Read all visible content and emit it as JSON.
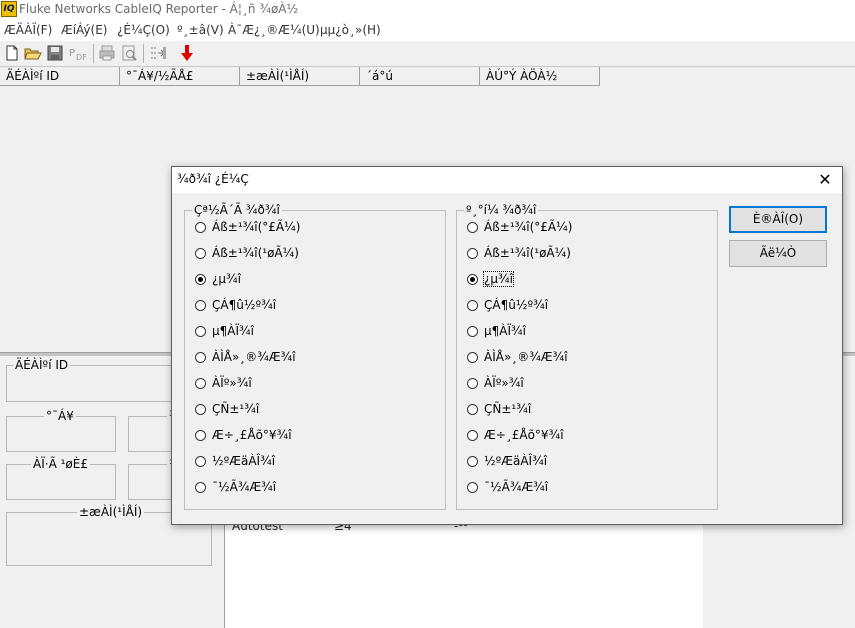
{
  "window": {
    "app_icon_text": "IQ",
    "title": "Fluke Networks CableIQ Reporter - Á¦¸ñ ¾øÀ½"
  },
  "menu": [
    "ÆÄÀÏ(F)",
    "ÆíÁý(E)",
    "¿É¼Ç(O)",
    "º¸±â(V)",
    "À¯Æ¿¸®Æ¼(U)",
    "µµ¿ò¸»(H)"
  ],
  "toolbar": {
    "icons": [
      "new-file-icon",
      "open-folder-icon",
      "save-icon",
      "pdf-icon",
      "print-icon",
      "print-preview-icon",
      "import-icon",
      "download-arrow-icon"
    ],
    "pdf_text": "PDF"
  },
  "list_columns": [
    "ÄÉÀÌºí ID",
    "°¯Á¥/½ÃÅ£",
    "±æÀÌ(¹ÌÅÍ)",
    "´á°ú",
    "ÀÚ°Ý ÀÖÀ½"
  ],
  "detail_panel": {
    "cable_id_label": "ÄÉÀÌºí ID",
    "box1_label": "°¯Á¥",
    "box2_label": "ÀÏ·Ã ¹øÈ£",
    "length_label": "±æÀÌ(¹ÌÅÍ)",
    "right_label_1": "¾",
    "right_label_2": "¹"
  },
  "lower_list": {
    "cells": [
      "Autotest",
      "≥4",
      "-¹¹"
    ]
  },
  "dialog": {
    "title": "¾ð¾î ¿É¼Ç",
    "close_glyph": "✕",
    "left_group": {
      "label": "Çª½Ã´Ã ¾ð¾î",
      "options": [
        {
          "label": "Áß±¹¾î(°£Ã¼)",
          "checked": false
        },
        {
          "label": "Áß±¹¾î(¹øÃ¼)",
          "checked": false
        },
        {
          "label": "¿µ¾î",
          "checked": true
        },
        {
          "label": "ÇÁ¶û½º¾î",
          "checked": false
        },
        {
          "label": "µ¶ÀÏ¾î",
          "checked": false
        },
        {
          "label": "ÀÌÅ»¸®¾Æ¾î",
          "checked": false
        },
        {
          "label": "ÀÏº»¾î",
          "checked": false
        },
        {
          "label": "ÇÑ±¹¾î",
          "checked": false
        },
        {
          "label": "Æ÷¸£Åõ°¥¾î",
          "checked": false
        },
        {
          "label": "½ºÆäÀÎ¾î",
          "checked": false
        },
        {
          "label": "¯½Ã¾Æ¾î",
          "checked": false
        }
      ]
    },
    "right_group": {
      "label": "º¸°í¼­ ¾ð¾î",
      "options": [
        {
          "label": "Áß±¹¾î(°£Ã¼)",
          "checked": false
        },
        {
          "label": "Áß±¹¾î(¹øÃ¼)",
          "checked": false
        },
        {
          "label": "¿µ¾î",
          "checked": true
        },
        {
          "label": "ÇÁ¶û½º¾î",
          "checked": false
        },
        {
          "label": "µ¶ÀÏ¾î",
          "checked": false
        },
        {
          "label": "ÀÌÅ»¸®¾Æ¾î",
          "checked": false
        },
        {
          "label": "ÀÏº»¾î",
          "checked": false
        },
        {
          "label": "ÇÑ±¹¾î",
          "checked": false
        },
        {
          "label": "Æ÷¸£Åõ°¥¾î",
          "checked": false
        },
        {
          "label": "½ºÆäÀÎ¾î",
          "checked": false
        },
        {
          "label": "¯½Ã¾Æ¾î",
          "checked": false
        }
      ]
    },
    "ok_label": "È®ÀÎ(O)",
    "cancel_label": "Ãë¼Ò"
  }
}
